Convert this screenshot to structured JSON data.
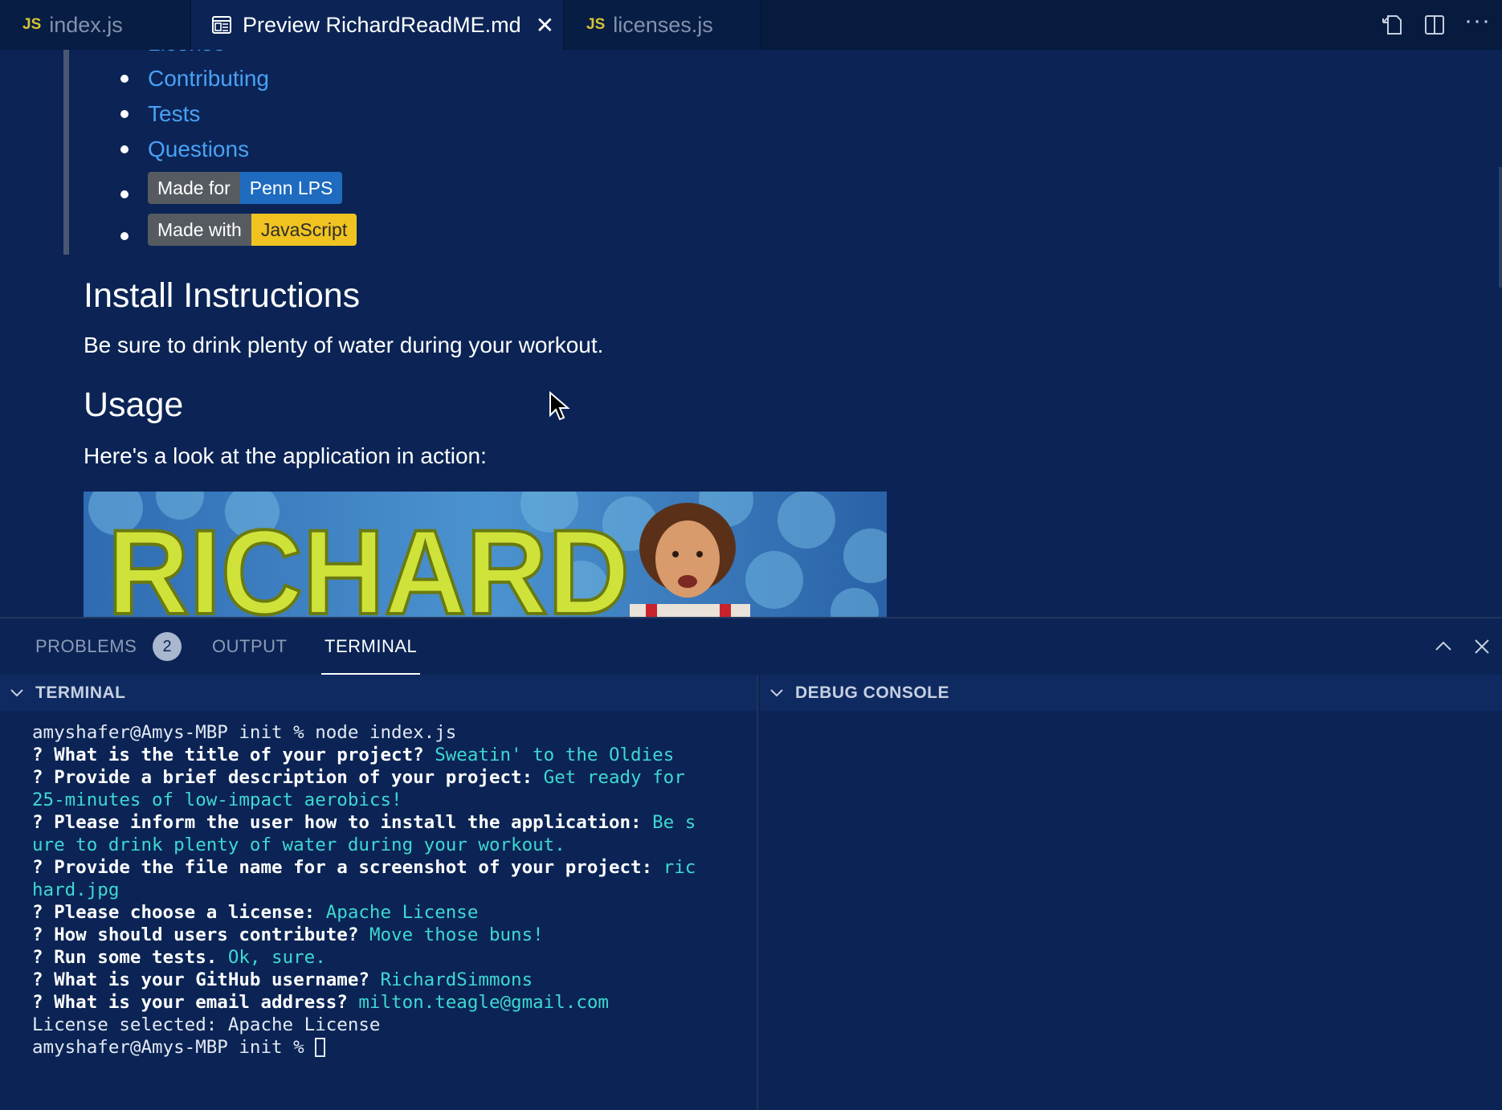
{
  "tabs": [
    {
      "label": "index.js",
      "icon": "js-file-icon",
      "icon_text": "JS"
    },
    {
      "label": "Preview RichardReadME.md",
      "icon": "preview-icon",
      "active": true
    },
    {
      "label": "licenses.js",
      "icon": "js-file-icon",
      "icon_text": "JS"
    }
  ],
  "tab_close": "✕",
  "tab_actions": {
    "more": "···"
  },
  "preview": {
    "toc": [
      {
        "label": "License"
      },
      {
        "label": "Contributing"
      },
      {
        "label": "Tests"
      },
      {
        "label": "Questions"
      }
    ],
    "badges": [
      {
        "left": "Made for",
        "right": "Penn LPS",
        "color": "#1e6bc0"
      },
      {
        "left": "Made with",
        "right": "JavaScript",
        "color": "#f0c320"
      }
    ],
    "install_heading": "Install Instructions",
    "install_text": "Be sure to drink plenty of water during your workout.",
    "usage_heading": "Usage",
    "usage_text": "Here's a look at the application in action:",
    "screenshot_text": "RICHARD"
  },
  "panel": {
    "tabs": [
      {
        "label": "PROBLEMS",
        "count": "2"
      },
      {
        "label": "OUTPUT"
      },
      {
        "label": "TERMINAL",
        "active": true
      }
    ],
    "terminal_header": "TERMINAL",
    "debug_header": "DEBUG CONSOLE"
  },
  "terminal": {
    "lines": [
      [
        {
          "t": "amyshafer@Amys-MBP init % node index.js",
          "s": "plain"
        }
      ],
      [
        {
          "t": "? What is the title of your project? ",
          "s": "q"
        },
        {
          "t": "Sweatin' to the Oldies",
          "s": "a"
        }
      ],
      [
        {
          "t": "? Provide a brief description of your project: ",
          "s": "q"
        },
        {
          "t": "Get ready for",
          "s": "a"
        }
      ],
      [
        {
          "t": "25-minutes of low-impact aerobics!",
          "s": "a"
        }
      ],
      [
        {
          "t": "? Please inform the user how to install the application: ",
          "s": "q"
        },
        {
          "t": "Be s",
          "s": "a"
        }
      ],
      [
        {
          "t": "ure to drink plenty of water during your workout.",
          "s": "a"
        }
      ],
      [
        {
          "t": "? Provide the file name for a screenshot of your project: ",
          "s": "q"
        },
        {
          "t": "ric",
          "s": "a"
        }
      ],
      [
        {
          "t": "hard.jpg",
          "s": "a"
        }
      ],
      [
        {
          "t": "? Please choose a license: ",
          "s": "q"
        },
        {
          "t": "Apache License",
          "s": "a"
        }
      ],
      [
        {
          "t": "? How should users contribute? ",
          "s": "q"
        },
        {
          "t": "Move those buns!",
          "s": "a"
        }
      ],
      [
        {
          "t": "? Run some tests. ",
          "s": "q"
        },
        {
          "t": "Ok, sure.",
          "s": "a"
        }
      ],
      [
        {
          "t": "? What is your GitHub username? ",
          "s": "q"
        },
        {
          "t": "RichardSimmons",
          "s": "a"
        }
      ],
      [
        {
          "t": "? What is your email address? ",
          "s": "q"
        },
        {
          "t": "milton.teagle@gmail.com",
          "s": "a"
        }
      ],
      [
        {
          "t": "License selected: Apache License",
          "s": "plain"
        }
      ],
      [
        {
          "t": "amyshafer@Amys-MBP init % ",
          "s": "plain"
        }
      ]
    ]
  },
  "colors": {
    "background": "#0b2455",
    "link": "#4aa1f5",
    "terminal_answer": "#3fd8d2"
  }
}
